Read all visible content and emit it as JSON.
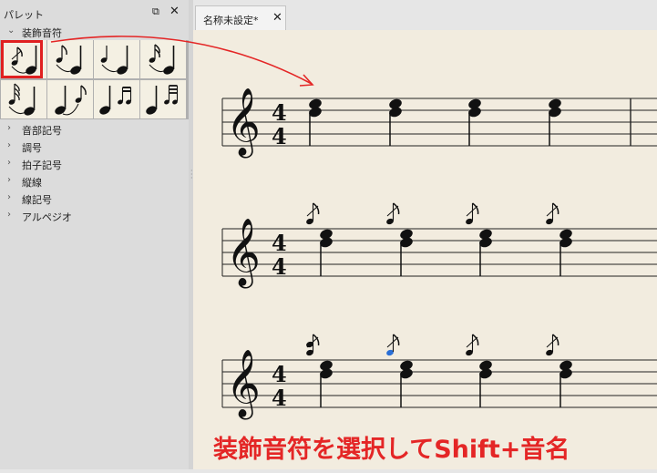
{
  "palette": {
    "title": "パレット",
    "float_icon": "float-window-icon",
    "close_icon": "close-icon",
    "expanded_section": "装飾音符",
    "collapsed_sections": [
      "音部記号",
      "調号",
      "拍子記号",
      "縦線",
      "線記号",
      "アルペジオ"
    ],
    "grace_notes": [
      {
        "icon": "acciaccatura-icon"
      },
      {
        "icon": "appoggiatura-icon"
      },
      {
        "icon": "grace-quarter-icon"
      },
      {
        "icon": "grace-sixteenth-icon"
      },
      {
        "icon": "grace-32nd-icon"
      },
      {
        "icon": "grace-eighth-after-icon"
      },
      {
        "icon": "grace-sixteenth-after-icon"
      },
      {
        "icon": "grace-32nd-after-icon"
      }
    ],
    "selected_index": 0
  },
  "tab": {
    "label": "名称未設定*"
  },
  "caption": "装飾音符を選択してShift+音名",
  "colors": {
    "highlight": "#e02020",
    "selected_note": "#2a6fd6",
    "paper": "#f2ecdf"
  }
}
